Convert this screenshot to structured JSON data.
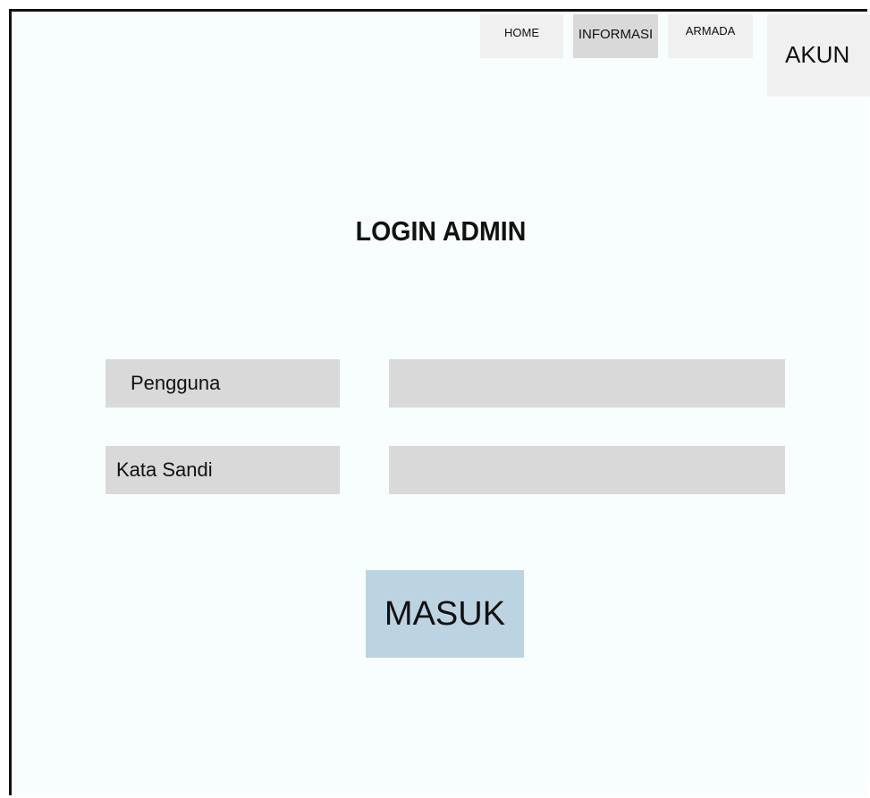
{
  "nav": {
    "home": "HOME",
    "informasi": "INFORMASI",
    "armada": "ARMADA",
    "akun": "AKUN"
  },
  "page_title": "LOGIN ADMIN",
  "form": {
    "username_label": "Pengguna",
    "password_label": "Kata Sandi",
    "username_value": "",
    "password_value": "",
    "submit_label": "MASUK"
  },
  "colors": {
    "background": "#f8fefe",
    "field": "#d9d9d9",
    "nav": "#f0f0f0",
    "active_nav": "#d9d9d9",
    "submit": "#bcd3e2"
  }
}
